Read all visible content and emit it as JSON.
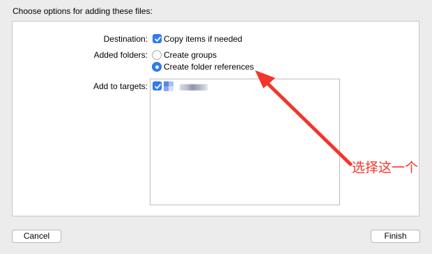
{
  "dialog": {
    "title": "Choose options for adding these files:"
  },
  "destination": {
    "label": "Destination:",
    "checkbox_label": "Copy items if needed",
    "checked": true
  },
  "added_folders": {
    "label": "Added folders:",
    "options": [
      {
        "label": "Create groups",
        "selected": false
      },
      {
        "label": "Create folder references",
        "selected": true
      }
    ]
  },
  "targets": {
    "label": "Add to targets:",
    "items": [
      {
        "checked": true,
        "icon": "app-target-icon"
      }
    ]
  },
  "annotation": {
    "text": "选择这一个",
    "color": "#f5342a"
  },
  "buttons": {
    "cancel": "Cancel",
    "finish": "Finish"
  },
  "colors": {
    "accent": "#2f7cf6",
    "annotation": "#f5342a"
  }
}
